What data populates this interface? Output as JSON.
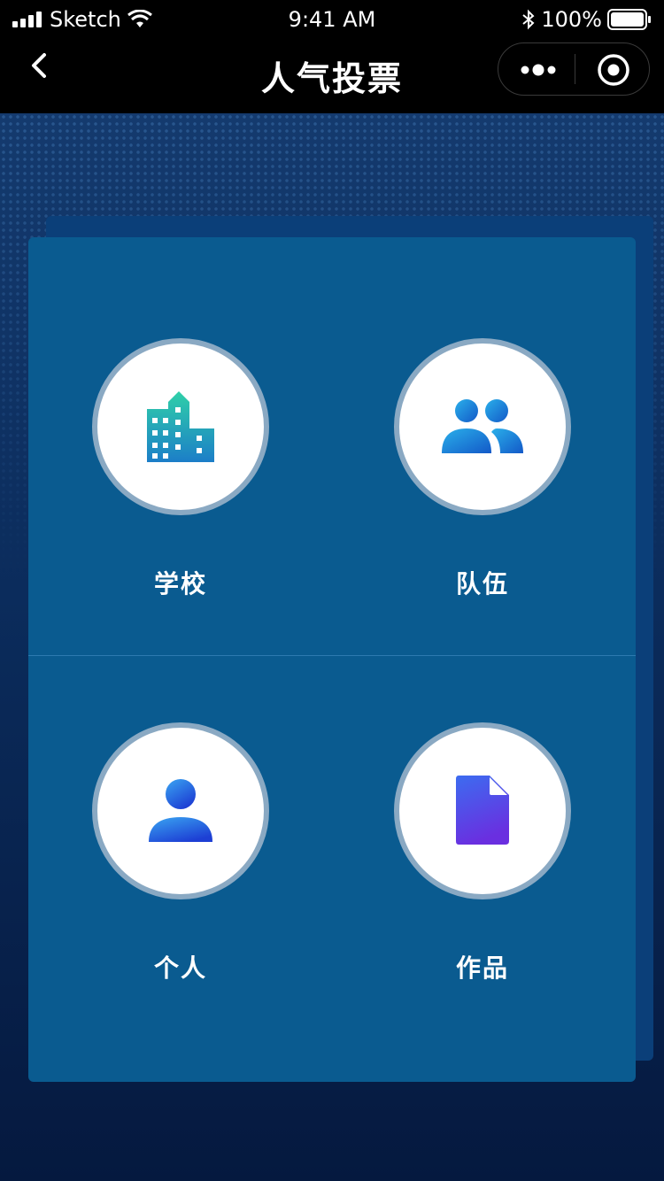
{
  "status_bar": {
    "carrier": "Sketch",
    "time": "9:41 AM",
    "battery": "100%"
  },
  "nav": {
    "title": "人气投票"
  },
  "options": [
    {
      "label": "学校",
      "icon": "school-building-icon"
    },
    {
      "label": "队伍",
      "icon": "team-icon"
    },
    {
      "label": "个人",
      "icon": "person-icon"
    },
    {
      "label": "作品",
      "icon": "document-icon"
    }
  ],
  "colors": {
    "card": "#0a5b90",
    "back_card": "#0b3f79",
    "circle_border": "#8aa9c3"
  }
}
